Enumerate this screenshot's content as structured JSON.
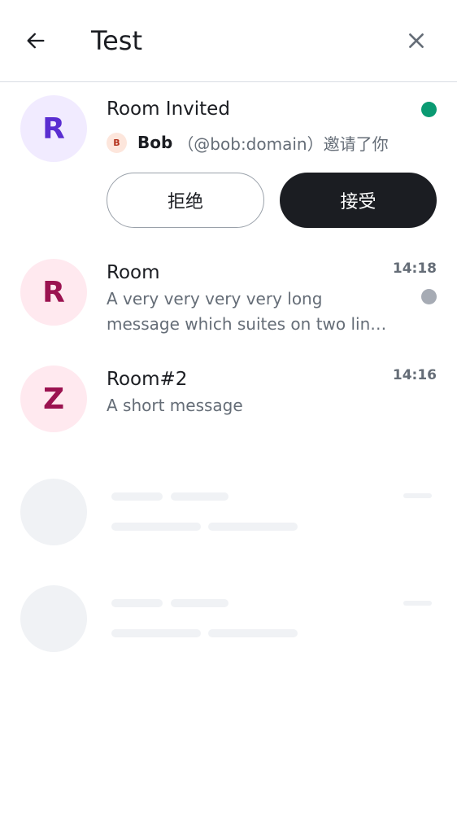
{
  "header": {
    "title": "Test",
    "back_icon": "arrow-left-icon",
    "close_icon": "close-icon"
  },
  "invite": {
    "avatar_letter": "R",
    "avatar_bg": "#f1ebff",
    "avatar_fg": "#5a2ed1",
    "room_name": "Room Invited",
    "unread_dot_color": "#0a9a72",
    "inviter_avatar_letter": "B",
    "inviter_name": "Bob",
    "inviter_text": "（@bob:domain）邀请了你",
    "decline_label": "拒绝",
    "accept_label": "接受"
  },
  "rooms": [
    {
      "avatar_letter": "R",
      "avatar_bg": "#ffe9ef",
      "avatar_fg": "#9b1350",
      "name": "Room",
      "message_line1": "A very very very very long",
      "message_line2": "message which suites on two lin…",
      "time": "14:18",
      "unread_dot_color": "#a6abb4"
    },
    {
      "avatar_letter": "Z",
      "avatar_bg": "#ffe9ef",
      "avatar_fg": "#9b1350",
      "name": "Room#2",
      "message_line1": "A short message",
      "time": "14:16"
    }
  ],
  "colors": {
    "text_primary": "#1b1d22",
    "text_secondary": "#656d77",
    "divider": "#d9dde3",
    "skeleton": "#f0f2f5"
  }
}
